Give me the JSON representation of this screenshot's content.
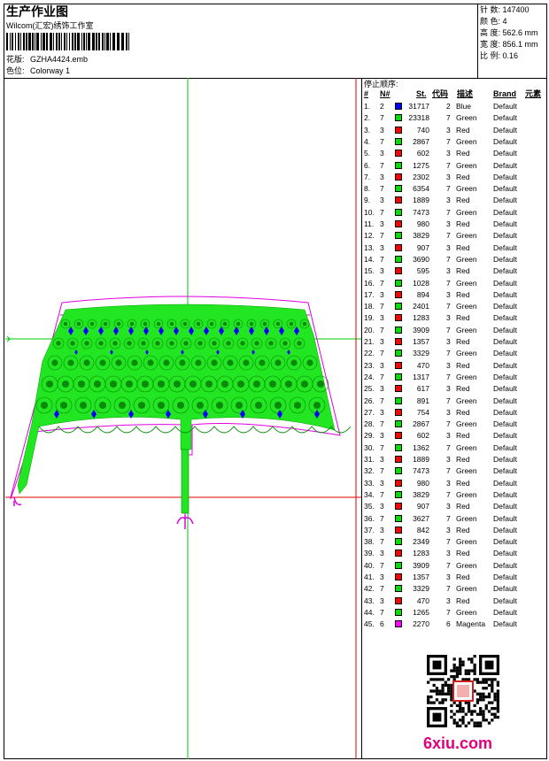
{
  "header": {
    "title": "生产作业图",
    "company": "Wilcom(汇宏)绣饰工作室",
    "design_label": "花版:",
    "design_value": "GZHA4424.emb",
    "colorway_label": "色位:",
    "colorway_value": "Colorway 1"
  },
  "stats": {
    "stitches": "针 数: 147400",
    "colors": "颜 色: 4",
    "height": "高 度: 562.6 mm",
    "width": "宽 度: 856.1 mm",
    "scale": "比 例: 0.16"
  },
  "stop_sequence": {
    "title": "停止顺序:",
    "headers": [
      "#",
      "N#",
      "St.",
      "代码",
      "描述",
      "Brand",
      "元素"
    ]
  },
  "colors": {
    "Blue": "#0000ff",
    "Green": "#00e000",
    "Red": "#ff0000",
    "Magenta": "#ff00ff",
    "guide_green": "#00c800",
    "guide_red": "#e00000",
    "outline_magenta": "#e000e0"
  },
  "rows": [
    {
      "n": "1.",
      "nn": "2",
      "st": "31717",
      "code": "2",
      "desc": "Blue",
      "brand": "Default"
    },
    {
      "n": "2.",
      "nn": "7",
      "st": "23318",
      "code": "7",
      "desc": "Green",
      "brand": "Default"
    },
    {
      "n": "3.",
      "nn": "3",
      "st": "740",
      "code": "3",
      "desc": "Red",
      "brand": "Default"
    },
    {
      "n": "4.",
      "nn": "7",
      "st": "2867",
      "code": "7",
      "desc": "Green",
      "brand": "Default"
    },
    {
      "n": "5.",
      "nn": "3",
      "st": "602",
      "code": "3",
      "desc": "Red",
      "brand": "Default"
    },
    {
      "n": "6.",
      "nn": "7",
      "st": "1275",
      "code": "7",
      "desc": "Green",
      "brand": "Default"
    },
    {
      "n": "7.",
      "nn": "3",
      "st": "2302",
      "code": "3",
      "desc": "Red",
      "brand": "Default"
    },
    {
      "n": "8.",
      "nn": "7",
      "st": "6354",
      "code": "7",
      "desc": "Green",
      "brand": "Default"
    },
    {
      "n": "9.",
      "nn": "3",
      "st": "1889",
      "code": "3",
      "desc": "Red",
      "brand": "Default"
    },
    {
      "n": "10.",
      "nn": "7",
      "st": "7473",
      "code": "7",
      "desc": "Green",
      "brand": "Default"
    },
    {
      "n": "11.",
      "nn": "3",
      "st": "980",
      "code": "3",
      "desc": "Red",
      "brand": "Default"
    },
    {
      "n": "12.",
      "nn": "7",
      "st": "3829",
      "code": "7",
      "desc": "Green",
      "brand": "Default"
    },
    {
      "n": "13.",
      "nn": "3",
      "st": "907",
      "code": "3",
      "desc": "Red",
      "brand": "Default"
    },
    {
      "n": "14.",
      "nn": "7",
      "st": "3690",
      "code": "7",
      "desc": "Green",
      "brand": "Default"
    },
    {
      "n": "15.",
      "nn": "3",
      "st": "595",
      "code": "3",
      "desc": "Red",
      "brand": "Default"
    },
    {
      "n": "16.",
      "nn": "7",
      "st": "1028",
      "code": "7",
      "desc": "Green",
      "brand": "Default"
    },
    {
      "n": "17.",
      "nn": "3",
      "st": "894",
      "code": "3",
      "desc": "Red",
      "brand": "Default"
    },
    {
      "n": "18.",
      "nn": "7",
      "st": "2401",
      "code": "7",
      "desc": "Green",
      "brand": "Default"
    },
    {
      "n": "19.",
      "nn": "3",
      "st": "1283",
      "code": "3",
      "desc": "Red",
      "brand": "Default"
    },
    {
      "n": "20.",
      "nn": "7",
      "st": "3909",
      "code": "7",
      "desc": "Green",
      "brand": "Default"
    },
    {
      "n": "21.",
      "nn": "3",
      "st": "1357",
      "code": "3",
      "desc": "Red",
      "brand": "Default"
    },
    {
      "n": "22.",
      "nn": "7",
      "st": "3329",
      "code": "7",
      "desc": "Green",
      "brand": "Default"
    },
    {
      "n": "23.",
      "nn": "3",
      "st": "470",
      "code": "3",
      "desc": "Red",
      "brand": "Default"
    },
    {
      "n": "24.",
      "nn": "7",
      "st": "1317",
      "code": "7",
      "desc": "Green",
      "brand": "Default"
    },
    {
      "n": "25.",
      "nn": "3",
      "st": "617",
      "code": "3",
      "desc": "Red",
      "brand": "Default"
    },
    {
      "n": "26.",
      "nn": "7",
      "st": "891",
      "code": "7",
      "desc": "Green",
      "brand": "Default"
    },
    {
      "n": "27.",
      "nn": "3",
      "st": "754",
      "code": "3",
      "desc": "Red",
      "brand": "Default"
    },
    {
      "n": "28.",
      "nn": "7",
      "st": "2867",
      "code": "7",
      "desc": "Green",
      "brand": "Default"
    },
    {
      "n": "29.",
      "nn": "3",
      "st": "602",
      "code": "3",
      "desc": "Red",
      "brand": "Default"
    },
    {
      "n": "30.",
      "nn": "7",
      "st": "1362",
      "code": "7",
      "desc": "Green",
      "brand": "Default"
    },
    {
      "n": "31.",
      "nn": "3",
      "st": "1889",
      "code": "3",
      "desc": "Red",
      "brand": "Default"
    },
    {
      "n": "32.",
      "nn": "7",
      "st": "7473",
      "code": "7",
      "desc": "Green",
      "brand": "Default"
    },
    {
      "n": "33.",
      "nn": "3",
      "st": "980",
      "code": "3",
      "desc": "Red",
      "brand": "Default"
    },
    {
      "n": "34.",
      "nn": "7",
      "st": "3829",
      "code": "7",
      "desc": "Green",
      "brand": "Default"
    },
    {
      "n": "35.",
      "nn": "3",
      "st": "907",
      "code": "3",
      "desc": "Red",
      "brand": "Default"
    },
    {
      "n": "36.",
      "nn": "7",
      "st": "3627",
      "code": "7",
      "desc": "Green",
      "brand": "Default"
    },
    {
      "n": "37.",
      "nn": "3",
      "st": "842",
      "code": "3",
      "desc": "Red",
      "brand": "Default"
    },
    {
      "n": "38.",
      "nn": "7",
      "st": "2349",
      "code": "7",
      "desc": "Green",
      "brand": "Default"
    },
    {
      "n": "39.",
      "nn": "3",
      "st": "1283",
      "code": "3",
      "desc": "Red",
      "brand": "Default"
    },
    {
      "n": "40.",
      "nn": "7",
      "st": "3909",
      "code": "7",
      "desc": "Green",
      "brand": "Default"
    },
    {
      "n": "41.",
      "nn": "3",
      "st": "1357",
      "code": "3",
      "desc": "Red",
      "brand": "Default"
    },
    {
      "n": "42.",
      "nn": "7",
      "st": "3329",
      "code": "7",
      "desc": "Green",
      "brand": "Default"
    },
    {
      "n": "43.",
      "nn": "3",
      "st": "470",
      "code": "3",
      "desc": "Red",
      "brand": "Default"
    },
    {
      "n": "44.",
      "nn": "7",
      "st": "1265",
      "code": "7",
      "desc": "Green",
      "brand": "Default"
    },
    {
      "n": "45.",
      "nn": "6",
      "st": "2270",
      "code": "6",
      "desc": "Magenta",
      "brand": "Default"
    }
  ],
  "watermark": {
    "site": "6xiu.com",
    "stamp_icon": "seal-stamp-icon",
    "qr_icon": "qr-code-icon"
  }
}
